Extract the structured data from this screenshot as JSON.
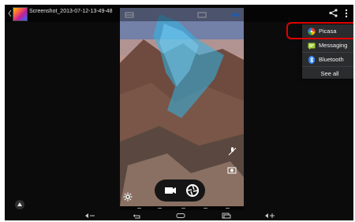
{
  "header": {
    "filename": "Screenshot_2013-07-12-13-49-48",
    "back_icon": "chevron-left-icon",
    "share_icon": "share-icon",
    "overflow_icon": "overflow-menu-icon"
  },
  "share_menu": {
    "items": [
      {
        "label": "Picasa",
        "icon": "picasa-icon"
      },
      {
        "label": "Messaging",
        "icon": "messaging-icon"
      },
      {
        "label": "Bluetooth",
        "icon": "bluetooth-icon"
      }
    ],
    "see_all_label": "See all",
    "highlight_color": "#e00000"
  },
  "camera_preview": {
    "top_icons": [
      "landscape-mode-icon",
      "crop-icon",
      "panorama-icon"
    ],
    "side_icons": [
      "microphone-off-icon",
      "exposure-icon"
    ],
    "settings_icon": "settings-gear-icon",
    "mode_buttons": [
      "video-camera-icon",
      "shutter-icon"
    ]
  },
  "navigation": {
    "icons": [
      "volume-down-icon",
      "back-icon",
      "home-icon",
      "recent-apps-icon",
      "volume-up-icon"
    ]
  },
  "bottom_left_icon": "gallery-badge-icon"
}
